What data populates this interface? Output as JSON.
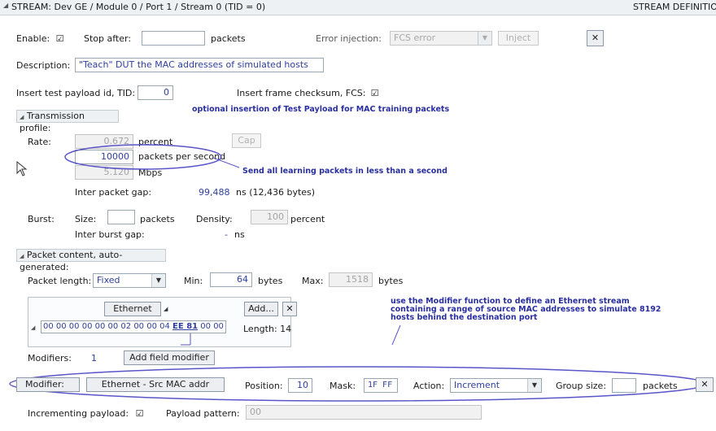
{
  "title_bar": {
    "path": "STREAM: Dev GE / Module 0 / Port 1 / Stream  0  (TID = 0)",
    "right_label": "STREAM DEFINITION"
  },
  "row_enable": {
    "enable_label": "Enable:",
    "enable_checked": "☑",
    "stop_after_label": "Stop after:",
    "stop_after_value": "",
    "packets_label": "packets",
    "error_injection_label": "Error injection:",
    "error_injection_value": "FCS error",
    "inject_button": "Inject",
    "close_symbol": "✕"
  },
  "row_description": {
    "label": "Description:",
    "value": "\"Teach\" DUT the MAC addresses of simulated hosts"
  },
  "row_tid": {
    "tid_label": "Insert test payload id, TID:",
    "tid_value": "0",
    "fcs_label": "Insert frame checksum, FCS:",
    "fcs_checked": "☑"
  },
  "annotations": {
    "note1": "optional insertion of Test Payload for MAC training packets",
    "note2": "Send all learning packets in less than a second",
    "note3": "use the Modifier function to define an Ethernet stream containing a range of source MAC addresses to simulate 8192 hosts behind the destination port"
  },
  "transmission": {
    "section_label": "Transmission profile:",
    "rate_label": "Rate:",
    "rate_percent_value": "0.672",
    "rate_percent_unit": "percent",
    "cap_button": "Cap",
    "pps_value": "10000",
    "pps_unit": "packets per second",
    "mbps_value": "5.120",
    "mbps_unit": "Mbps",
    "ipg_label": "Inter packet gap:",
    "ipg_value": "99,488",
    "ipg_unit": "ns  (12,436 bytes)",
    "burst_label": "Burst:",
    "size_label": "Size:",
    "size_value": "",
    "size_unit": "packets",
    "density_label": "Density:",
    "density_value": "100",
    "density_unit": "percent",
    "ibg_label": "Inter burst gap:",
    "ibg_value": "-",
    "ibg_unit": "ns"
  },
  "packet_content": {
    "section_label": "Packet content, auto-generated:",
    "length_label": "Packet length:",
    "length_type": "Fixed",
    "min_label": "Min:",
    "min_value": "64",
    "min_unit": "bytes",
    "max_label": "Max:",
    "max_value": "1518",
    "max_unit": "bytes",
    "ethernet_button": "Ethernet",
    "add_button": "Add...",
    "remove_symbol": "✕",
    "hex_prefix": "00 00 00 00 00 00 02 00 00 04 ",
    "hex_highlight": "EE 81",
    "hex_suffix": " 00 00",
    "length_text": "Length: 14",
    "modifiers_label": "Modifiers:",
    "modifiers_count": "1",
    "add_field_modifier_button": "Add field modifier"
  },
  "modifier": {
    "label": "Modifier:",
    "field_button": "Ethernet - Src MAC addr",
    "position_label": "Position:",
    "position_value": "10",
    "mask_label": "Mask:",
    "mask_value": "1F FF",
    "action_label": "Action:",
    "action_value": "Increment",
    "group_size_label": "Group size:",
    "group_size_value": "",
    "packets_label": "packets",
    "close_symbol": "✕"
  },
  "payload": {
    "incrementing_label": "Incrementing payload:",
    "incrementing_checked": "☑",
    "pattern_label": "Payload pattern:",
    "pattern_value": "00"
  },
  "colors": {
    "accent_blue": "#2f3f9f",
    "annotation_blue": "#2a2fa0",
    "ellipse_blue": "#5a55c8"
  }
}
